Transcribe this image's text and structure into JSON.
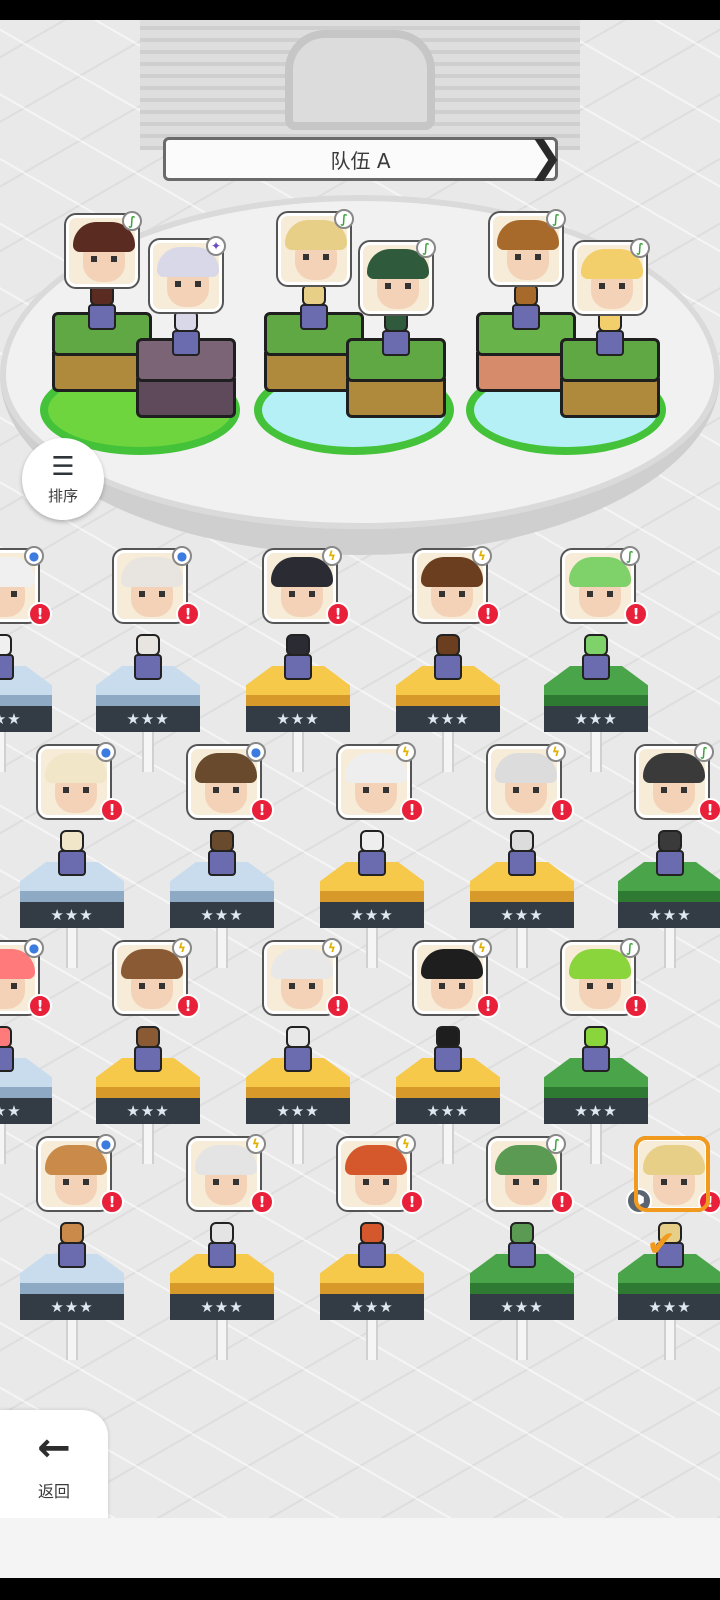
{
  "team": {
    "title": "队伍 A",
    "arrow_left": "❮",
    "arrow_right": "❯"
  },
  "sort": {
    "label": "排序",
    "icon": "sort-descending-icon"
  },
  "back": {
    "label": "返回",
    "icon": "arrow-left-icon"
  },
  "party": [
    {
      "hair": "#5a2b20",
      "badge": "leaf",
      "badge_glyph": "∫",
      "block": "grass"
    },
    {
      "hair": "#d8d8e8",
      "badge": "star",
      "badge_glyph": "✦",
      "block": "stone"
    },
    {
      "hair": "#e8cf88",
      "badge": "leaf",
      "badge_glyph": "∫",
      "block": "grass"
    },
    {
      "hair": "#2f5a3c",
      "badge": "leaf",
      "badge_glyph": "∫",
      "block": "grass"
    },
    {
      "hair": "#a86a2a",
      "badge": "leaf",
      "badge_glyph": "∫",
      "block": "clay"
    },
    {
      "hair": "#f2cf6a",
      "badge": "leaf",
      "badge_glyph": "∫",
      "block": "grass"
    }
  ],
  "roster": [
    {
      "hair": "#f0f0f0",
      "badge": "orb",
      "badge_glyph": "●",
      "pedestal": "blue",
      "stars": "★★★",
      "alert": "!"
    },
    {
      "hair": "#e8e4df",
      "badge": "orb",
      "badge_glyph": "●",
      "pedestal": "blue",
      "stars": "★★★",
      "alert": "!"
    },
    {
      "hair": "#2b2b33",
      "badge": "bolt",
      "badge_glyph": "ϟ",
      "pedestal": "gold",
      "stars": "★★★",
      "alert": "!"
    },
    {
      "hair": "#6b3e20",
      "badge": "bolt",
      "badge_glyph": "ϟ",
      "pedestal": "gold",
      "stars": "★★★",
      "alert": "!"
    },
    {
      "hair": "#7fd16a",
      "badge": "leaf",
      "badge_glyph": "∫",
      "pedestal": "green",
      "stars": "★★★",
      "alert": "!"
    },
    {
      "hair": "#f2e6c8",
      "badge": "orb",
      "badge_glyph": "●",
      "pedestal": "blue",
      "stars": "★★★",
      "alert": "!"
    },
    {
      "hair": "#6a4a2c",
      "badge": "orb",
      "badge_glyph": "●",
      "pedestal": "blue",
      "stars": "★★★",
      "alert": "!"
    },
    {
      "hair": "#eeeeee",
      "badge": "bolt",
      "badge_glyph": "ϟ",
      "pedestal": "gold",
      "stars": "★★★",
      "alert": "!"
    },
    {
      "hair": "#dcdcdc",
      "badge": "bolt",
      "badge_glyph": "ϟ",
      "pedestal": "gold",
      "stars": "★★★",
      "alert": "!"
    },
    {
      "hair": "#3a3a3a",
      "badge": "leaf",
      "badge_glyph": "∫",
      "pedestal": "green",
      "stars": "★★★",
      "alert": "!"
    },
    {
      "hair": "#ff7a7a",
      "badge": "orb",
      "badge_glyph": "●",
      "pedestal": "blue",
      "stars": "★★★",
      "alert": "!"
    },
    {
      "hair": "#8a5a34",
      "badge": "bolt",
      "badge_glyph": "ϟ",
      "pedestal": "gold",
      "stars": "★★★",
      "alert": "!"
    },
    {
      "hair": "#e8e8e8",
      "badge": "bolt",
      "badge_glyph": "ϟ",
      "pedestal": "gold",
      "stars": "★★★",
      "alert": "!"
    },
    {
      "hair": "#1e1e1e",
      "badge": "bolt",
      "badge_glyph": "ϟ",
      "pedestal": "gold",
      "stars": "★★★",
      "alert": "!"
    },
    {
      "hair": "#8ad43c",
      "badge": "leaf",
      "badge_glyph": "∫",
      "pedestal": "green",
      "stars": "★★★",
      "alert": "!"
    },
    {
      "hair": "#c98a4a",
      "badge": "orb",
      "badge_glyph": "●",
      "pedestal": "blue",
      "stars": "★★★",
      "alert": "!"
    },
    {
      "hair": "#e4e4e4",
      "badge": "bolt",
      "badge_glyph": "ϟ",
      "pedestal": "gold",
      "stars": "★★★",
      "alert": "!"
    },
    {
      "hair": "#d5582c",
      "badge": "bolt",
      "badge_glyph": "ϟ",
      "pedestal": "gold",
      "stars": "★★★",
      "alert": "!"
    },
    {
      "hair": "#5a9a52",
      "badge": "leaf",
      "badge_glyph": "∫",
      "pedestal": "green",
      "stars": "★★★",
      "alert": "!"
    },
    {
      "hair": "#e8cf88",
      "badge": "cube",
      "badge_glyph": "⬢",
      "pedestal": "green",
      "stars": "★★★",
      "alert": "!",
      "selected": true,
      "check": "✔"
    }
  ],
  "colors": {
    "alert": "#e8203a",
    "selected": "#f29a1d",
    "ring": "#44c33a",
    "ring_fill": "#b6f0f7"
  }
}
